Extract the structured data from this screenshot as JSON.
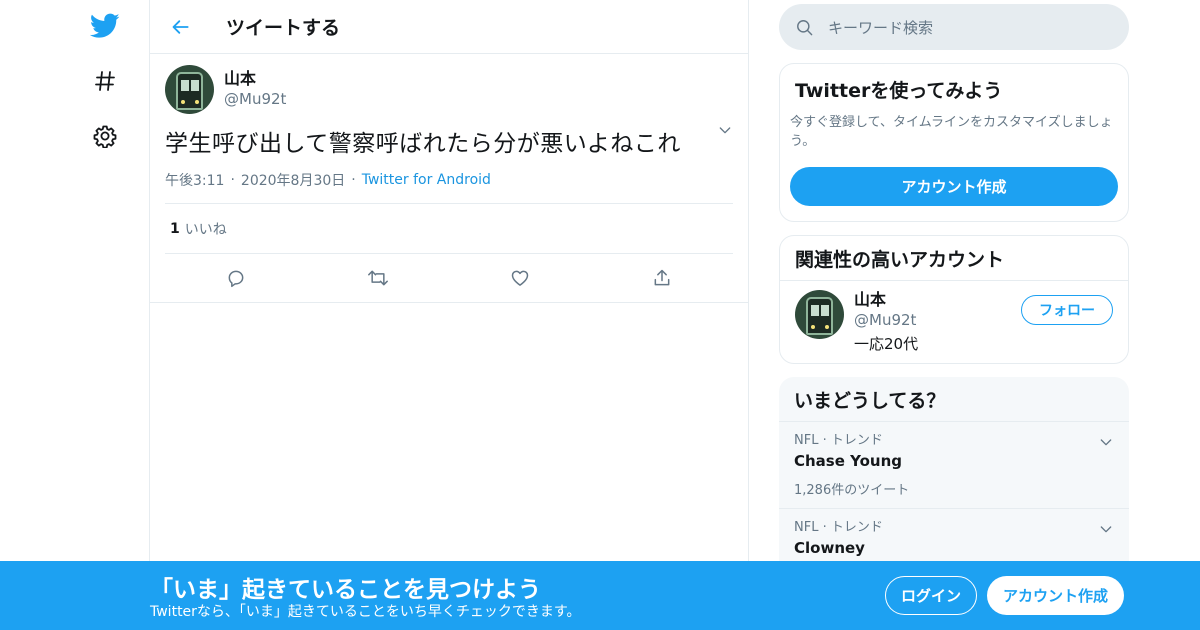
{
  "nav": {
    "icons": [
      "twitter-bird-icon",
      "hashtag-icon",
      "gear-icon"
    ]
  },
  "header": {
    "title": "ツイートする"
  },
  "tweet": {
    "author_name": "山本",
    "author_handle": "@Mu92t",
    "text": "学生呼び出して警察呼ばれたら分が悪いよねこれ",
    "time": "午後3:11",
    "separator": "·",
    "date": "2020年8月30日",
    "client": "Twitter for Android",
    "like_count": "1",
    "like_label": "いいね"
  },
  "search": {
    "placeholder": "キーワード検索"
  },
  "signup_card": {
    "title": "Twitterを使ってみよう",
    "subtitle": "今すぐ登録して、タイムラインをカスタマイズしましょう。",
    "button": "アカウント作成"
  },
  "related_card": {
    "title": "関連性の高いアカウント",
    "user_name": "山本",
    "user_handle": "@Mu92t",
    "user_bio": "一応20代",
    "follow_button": "フォロー"
  },
  "trends_card": {
    "title": "いまどうしてる？",
    "items": [
      {
        "context": "NFL · トレンド",
        "name": "Chase Young",
        "count": "1,286件のツイート"
      },
      {
        "context": "NFL · トレンド",
        "name": "Clowney",
        "count": ""
      }
    ]
  },
  "banner": {
    "title": "「いま」起きていることを見つけよう",
    "subtitle": "Twitterなら、「いま」起きていることをいち早くチェックできます。",
    "login": "ログイン",
    "signup": "アカウント作成"
  },
  "colors": {
    "accent": "#1da1f2",
    "text": "#14171a",
    "secondary": "#657786",
    "border": "#e6ecf0"
  }
}
